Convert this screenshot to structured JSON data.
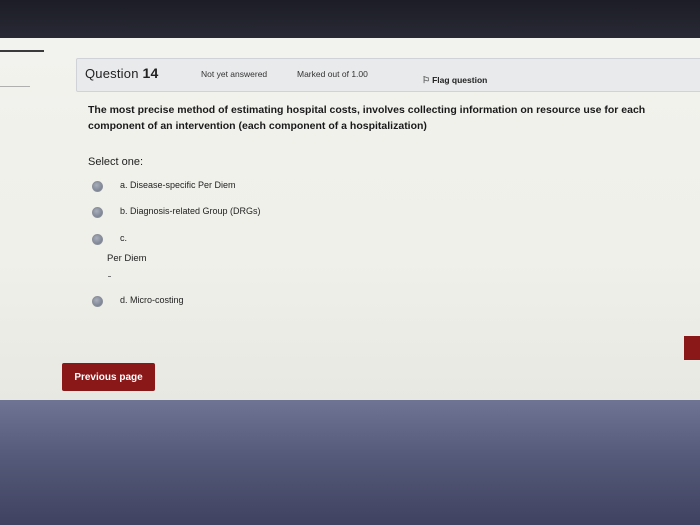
{
  "question": {
    "title_prefix": "Question",
    "number": "14",
    "status": "Not yet answered",
    "marks": "Marked out of 1.00",
    "flag_label": "Flag question",
    "text": "The most precise method of estimating hospital costs, involves collecting information on resource use for each component of an intervention (each component of a hospitalization)"
  },
  "answer": {
    "prompt": "Select one:",
    "options": [
      {
        "label": "a. Disease-specific Per Diem"
      },
      {
        "label": "b. Diagnosis-related Group (DRGs)"
      },
      {
        "label": "c.",
        "label2": "Per Diem"
      },
      {
        "label": "d. Micro-costing"
      }
    ]
  },
  "navigation": {
    "previous_label": "Previous page"
  },
  "colors": {
    "button_red": "#8a1818",
    "page_bg": "#f2f2ee",
    "info_box_bg": "#e9eaec"
  },
  "icons": {
    "flag": "flag-icon"
  }
}
